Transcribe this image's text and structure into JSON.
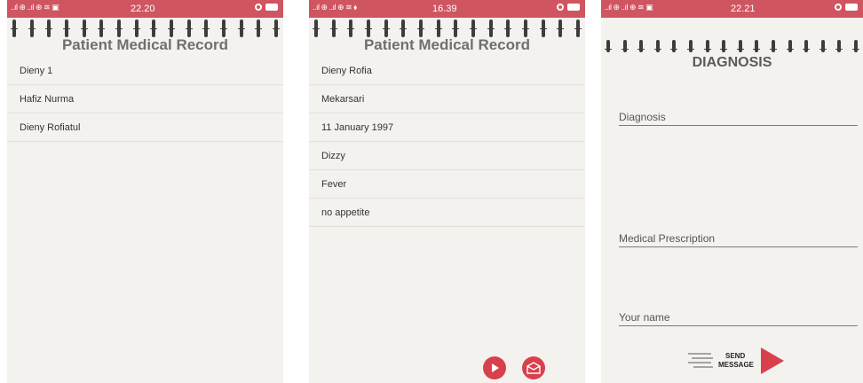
{
  "screen1": {
    "status": {
      "signal": "..ıl ⊕ ..ıl ⊕ ≋ ▣",
      "time": "22.20"
    },
    "title": "Patient Medical Record",
    "items": [
      "Dieny 1",
      "Hafiz Nurma",
      "Dieny Rofiatul"
    ]
  },
  "screen2": {
    "status": {
      "signal": "..ıl ⊕ ..ıl ⊕ ≋ ⬧",
      "time": "16.39"
    },
    "title": "Patient Medical Record",
    "items": [
      "Dieny Rofia",
      "Mekarsari",
      "11 January 1997",
      "Dizzy",
      "Fever",
      "no appetite"
    ],
    "actions": {
      "play_icon": "play-icon",
      "mail_icon": "envelope-icon"
    }
  },
  "screen3": {
    "status": {
      "signal": "..ıl ⊕ ..ıl ⊕ ≋ ▣",
      "time": "22.21"
    },
    "title": "DIAGNOSIS",
    "fields": {
      "diagnosis": "Diagnosis",
      "prescription": "Medical Prescription",
      "name": "Your name"
    },
    "send_button": {
      "line1": "SEND",
      "line2": "MESSAGE"
    }
  },
  "colors": {
    "statusbar": "#cf5560",
    "accent": "#d8404c",
    "background": "#f4f2ef"
  }
}
